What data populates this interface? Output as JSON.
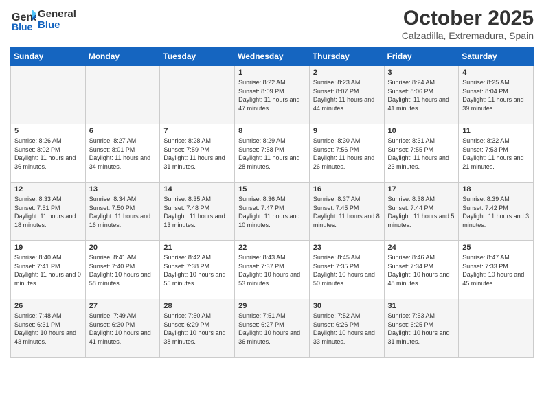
{
  "header": {
    "logo_line1": "General",
    "logo_line2": "Blue",
    "month": "October 2025",
    "location": "Calzadilla, Extremadura, Spain"
  },
  "days_of_week": [
    "Sunday",
    "Monday",
    "Tuesday",
    "Wednesday",
    "Thursday",
    "Friday",
    "Saturday"
  ],
  "weeks": [
    [
      {
        "day": "",
        "info": ""
      },
      {
        "day": "",
        "info": ""
      },
      {
        "day": "",
        "info": ""
      },
      {
        "day": "1",
        "info": "Sunrise: 8:22 AM\nSunset: 8:09 PM\nDaylight: 11 hours\nand 47 minutes."
      },
      {
        "day": "2",
        "info": "Sunrise: 8:23 AM\nSunset: 8:07 PM\nDaylight: 11 hours\nand 44 minutes."
      },
      {
        "day": "3",
        "info": "Sunrise: 8:24 AM\nSunset: 8:06 PM\nDaylight: 11 hours\nand 41 minutes."
      },
      {
        "day": "4",
        "info": "Sunrise: 8:25 AM\nSunset: 8:04 PM\nDaylight: 11 hours\nand 39 minutes."
      }
    ],
    [
      {
        "day": "5",
        "info": "Sunrise: 8:26 AM\nSunset: 8:02 PM\nDaylight: 11 hours\nand 36 minutes."
      },
      {
        "day": "6",
        "info": "Sunrise: 8:27 AM\nSunset: 8:01 PM\nDaylight: 11 hours\nand 34 minutes."
      },
      {
        "day": "7",
        "info": "Sunrise: 8:28 AM\nSunset: 7:59 PM\nDaylight: 11 hours\nand 31 minutes."
      },
      {
        "day": "8",
        "info": "Sunrise: 8:29 AM\nSunset: 7:58 PM\nDaylight: 11 hours\nand 28 minutes."
      },
      {
        "day": "9",
        "info": "Sunrise: 8:30 AM\nSunset: 7:56 PM\nDaylight: 11 hours\nand 26 minutes."
      },
      {
        "day": "10",
        "info": "Sunrise: 8:31 AM\nSunset: 7:55 PM\nDaylight: 11 hours\nand 23 minutes."
      },
      {
        "day": "11",
        "info": "Sunrise: 8:32 AM\nSunset: 7:53 PM\nDaylight: 11 hours\nand 21 minutes."
      }
    ],
    [
      {
        "day": "12",
        "info": "Sunrise: 8:33 AM\nSunset: 7:51 PM\nDaylight: 11 hours\nand 18 minutes."
      },
      {
        "day": "13",
        "info": "Sunrise: 8:34 AM\nSunset: 7:50 PM\nDaylight: 11 hours\nand 16 minutes."
      },
      {
        "day": "14",
        "info": "Sunrise: 8:35 AM\nSunset: 7:48 PM\nDaylight: 11 hours\nand 13 minutes."
      },
      {
        "day": "15",
        "info": "Sunrise: 8:36 AM\nSunset: 7:47 PM\nDaylight: 11 hours\nand 10 minutes."
      },
      {
        "day": "16",
        "info": "Sunrise: 8:37 AM\nSunset: 7:45 PM\nDaylight: 11 hours\nand 8 minutes."
      },
      {
        "day": "17",
        "info": "Sunrise: 8:38 AM\nSunset: 7:44 PM\nDaylight: 11 hours\nand 5 minutes."
      },
      {
        "day": "18",
        "info": "Sunrise: 8:39 AM\nSunset: 7:42 PM\nDaylight: 11 hours\nand 3 minutes."
      }
    ],
    [
      {
        "day": "19",
        "info": "Sunrise: 8:40 AM\nSunset: 7:41 PM\nDaylight: 11 hours\nand 0 minutes."
      },
      {
        "day": "20",
        "info": "Sunrise: 8:41 AM\nSunset: 7:40 PM\nDaylight: 10 hours\nand 58 minutes."
      },
      {
        "day": "21",
        "info": "Sunrise: 8:42 AM\nSunset: 7:38 PM\nDaylight: 10 hours\nand 55 minutes."
      },
      {
        "day": "22",
        "info": "Sunrise: 8:43 AM\nSunset: 7:37 PM\nDaylight: 10 hours\nand 53 minutes."
      },
      {
        "day": "23",
        "info": "Sunrise: 8:45 AM\nSunset: 7:35 PM\nDaylight: 10 hours\nand 50 minutes."
      },
      {
        "day": "24",
        "info": "Sunrise: 8:46 AM\nSunset: 7:34 PM\nDaylight: 10 hours\nand 48 minutes."
      },
      {
        "day": "25",
        "info": "Sunrise: 8:47 AM\nSunset: 7:33 PM\nDaylight: 10 hours\nand 45 minutes."
      }
    ],
    [
      {
        "day": "26",
        "info": "Sunrise: 7:48 AM\nSunset: 6:31 PM\nDaylight: 10 hours\nand 43 minutes."
      },
      {
        "day": "27",
        "info": "Sunrise: 7:49 AM\nSunset: 6:30 PM\nDaylight: 10 hours\nand 41 minutes."
      },
      {
        "day": "28",
        "info": "Sunrise: 7:50 AM\nSunset: 6:29 PM\nDaylight: 10 hours\nand 38 minutes."
      },
      {
        "day": "29",
        "info": "Sunrise: 7:51 AM\nSunset: 6:27 PM\nDaylight: 10 hours\nand 36 minutes."
      },
      {
        "day": "30",
        "info": "Sunrise: 7:52 AM\nSunset: 6:26 PM\nDaylight: 10 hours\nand 33 minutes."
      },
      {
        "day": "31",
        "info": "Sunrise: 7:53 AM\nSunset: 6:25 PM\nDaylight: 10 hours\nand 31 minutes."
      },
      {
        "day": "",
        "info": ""
      }
    ]
  ]
}
